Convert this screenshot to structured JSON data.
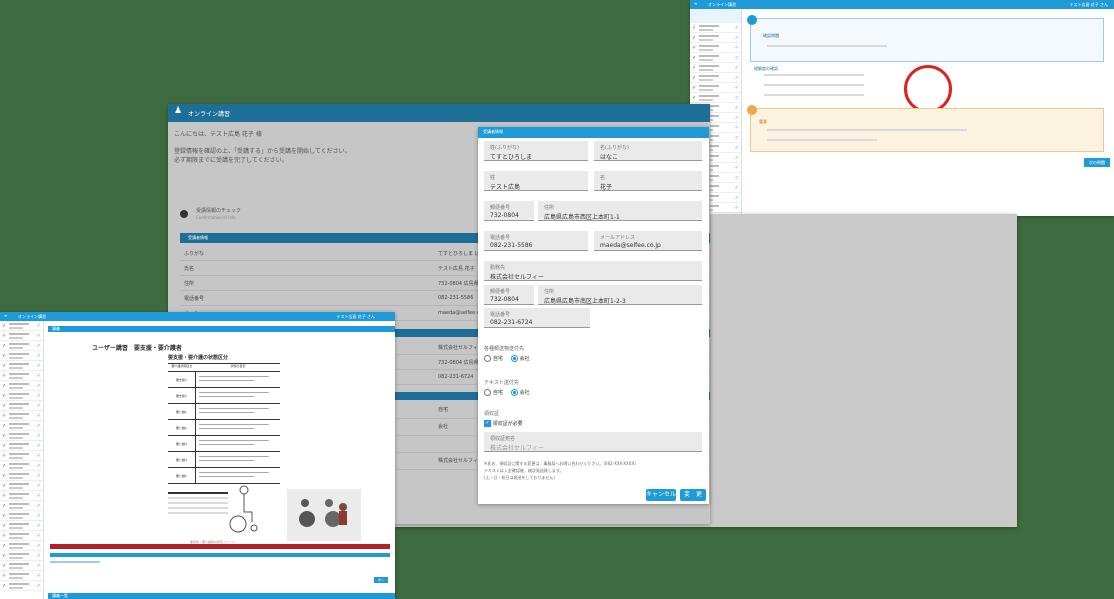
{
  "app": {
    "title": "オンライン講習",
    "top_right_user": "テスト広島 花子 さん"
  },
  "main_window": {
    "greeting": "こんにちは、テスト広島 花子 様",
    "instruction_line1": "登録情報を確認の上、「受講する」から受講を開始してください。",
    "instruction_line2": "必ず期限までに受講を完了してください。",
    "step_label": "受講情報のチェック",
    "step_sub": "Confirmation of Info",
    "section_header": "受講者情報",
    "edit_button": "変更",
    "rows": [
      {
        "label": "ふりがな",
        "value": "てすとひろしま はなこ"
      },
      {
        "label": "氏名",
        "value": "テスト広島 花子"
      },
      {
        "label": "住所",
        "value": "732-0804 広島県広島市..."
      },
      {
        "label": "電話番号",
        "value": "082-231-5586"
      },
      {
        "label": "メール",
        "value": "maeda@selfee.co.jp"
      }
    ],
    "rows2": [
      {
        "label": "勤務先",
        "value": "株式会社セルフィー"
      },
      {
        "label": "",
        "value": "732-0804 広島県..."
      },
      {
        "label": "",
        "value": "082-231-6724"
      }
    ],
    "rows3": [
      {
        "label": "",
        "value": "自宅"
      },
      {
        "label": "",
        "value": "会社"
      },
      {
        "label": "領収書",
        "value": ""
      },
      {
        "label": "",
        "value": "株式会社セルフィー"
      }
    ]
  },
  "dialog": {
    "title": "受講者情報",
    "fields": {
      "sei_kana": {
        "label": "姓(ふりがな)",
        "value": "てすとひろしま"
      },
      "mei_kana": {
        "label": "名(ふりがな)",
        "value": "はなこ"
      },
      "sei": {
        "label": "姓",
        "value": "テスト広島"
      },
      "mei": {
        "label": "名",
        "value": "花子"
      },
      "zip": {
        "label": "郵便番号",
        "value": "732-0804"
      },
      "address": {
        "label": "住所",
        "value": "広島県広島市西区上本町1-1"
      },
      "tel": {
        "label": "電話番号",
        "value": "082-231-5586"
      },
      "email": {
        "label": "メールアドレス",
        "value": "maeda@selfee.co.jp"
      },
      "company": {
        "label": "勤務先",
        "value": "株式会社セルフィー"
      },
      "company_zip": {
        "label": "郵便番号",
        "value": "732-0804"
      },
      "company_address": {
        "label": "住所",
        "value": "広島県広島市南区上本町1-2-3"
      },
      "company_tel": {
        "label": "電話番号",
        "value": "082-231-6724"
      }
    },
    "send_to": {
      "label": "各種郵送物送付先",
      "options": [
        "自宅",
        "会社"
      ],
      "selected": "会社"
    },
    "text_send": {
      "label": "テキスト送付先",
      "options": [
        "自宅",
        "会社"
      ],
      "selected": "会社"
    },
    "receipt": {
      "label": "領収証",
      "checkbox_label": "領収証が必要",
      "addressee_label": "領収証宛名",
      "addressee_value": "株式会社セルフィー"
    },
    "note_line1": "※氏名、領収証に関する変更は、事務局へお問い合わせください。(082-XXX-XXXX)",
    "note_line2": "テキストは入金確認後、順次発送致します。",
    "note_line3": "(土・日・祝日は発送をしておりません)",
    "cancel_label": "キャンセル",
    "ok_label": "変　更"
  },
  "left_window": {
    "title": "オンライン講習",
    "top_right": "テスト広島 花子 さん",
    "header_strip": "講義",
    "heading": "ユーザー講習　要支援・要介護者",
    "subheading": "要支援・要介護の状態区分",
    "table_headers": [
      "要介護状態区分",
      "状態の目安"
    ],
    "table_rows": [
      "要支援1",
      "要支援2",
      "要介護1",
      "要介護2",
      "要介護3",
      "要介護4",
      "要介護5"
    ],
    "figure_caption": "要支援・要介護者の想定イメージ",
    "next_button": "次へ",
    "footer_label": "講義一覧"
  },
  "right_window": {
    "title": "オンライン講習",
    "top_right": "テスト広島 花子 さん",
    "card1_title": "確認問題",
    "card2_title": "理解度の確認",
    "card3_title": "重要",
    "bottom_button": "次の問題"
  },
  "colors": {
    "brand": "#1e9bd7",
    "background": "#3f6b40",
    "warning_bg": "#fdf3e1",
    "warning_border": "#f2a54a",
    "red_circle": "#e02020",
    "dark_red": "#b0212a"
  }
}
